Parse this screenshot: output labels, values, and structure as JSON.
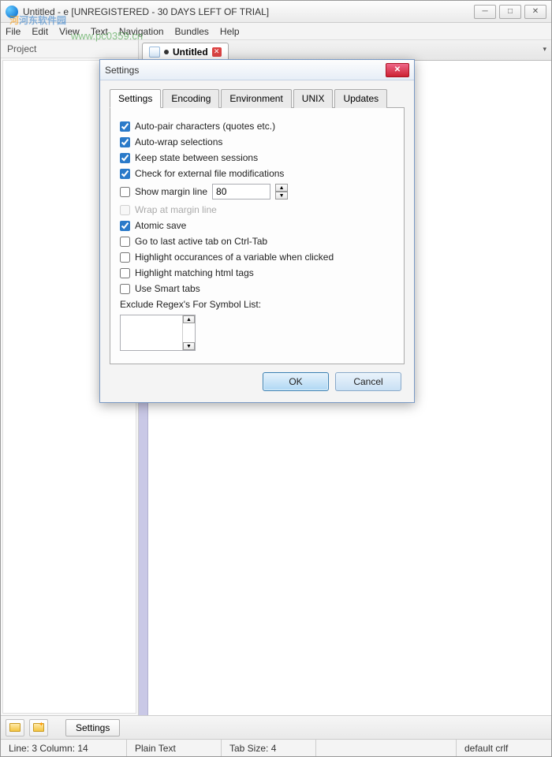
{
  "window": {
    "title": "Untitled - e [UNREGISTERED - 30 DAYS LEFT OF TRIAL]",
    "minimize": "─",
    "maximize": "□",
    "close": "✕"
  },
  "menubar": {
    "file": "File",
    "edit": "Edit",
    "view": "View",
    "text": "Text",
    "navigation": "Navigation",
    "bundles": "Bundles",
    "help": "Help"
  },
  "watermark_text": "河东软件园",
  "watermark_url": "www.pc0359.cn",
  "sidebar": {
    "header": "Project"
  },
  "tabs": {
    "doc_title": "Untitled"
  },
  "bottom_toolbar": {
    "settings_label": "Settings"
  },
  "statusbar": {
    "position": "Line: 3  Column: 14",
    "syntax": "Plain Text",
    "tabsize": "Tab Size: 4",
    "encoding": "default crlf"
  },
  "dialog": {
    "title": "Settings",
    "tabs": {
      "settings": "Settings",
      "encoding": "Encoding",
      "environment": "Environment",
      "unix": "UNIX",
      "updates": "Updates"
    },
    "options": {
      "auto_pair": {
        "label": "Auto-pair characters (quotes etc.)",
        "checked": true
      },
      "auto_wrap": {
        "label": "Auto-wrap selections",
        "checked": true
      },
      "keep_state": {
        "label": "Keep state between sessions",
        "checked": true
      },
      "check_external": {
        "label": "Check for external file modifications",
        "checked": true
      },
      "show_margin": {
        "label": "Show margin line",
        "checked": false,
        "value": "80"
      },
      "wrap_margin": {
        "label": "Wrap at margin line",
        "checked": false,
        "disabled": true
      },
      "atomic_save": {
        "label": "Atomic save",
        "checked": true
      },
      "last_tab": {
        "label": "Go to last active tab on Ctrl-Tab",
        "checked": false
      },
      "highlight_var": {
        "label": "Highlight occurances of a variable when clicked",
        "checked": false
      },
      "highlight_html": {
        "label": "Highlight matching html tags",
        "checked": false
      },
      "smart_tabs": {
        "label": "Use Smart tabs",
        "checked": false
      },
      "exclude_label": "Exclude Regex's For Symbol List:"
    },
    "buttons": {
      "ok": "OK",
      "cancel": "Cancel"
    }
  }
}
